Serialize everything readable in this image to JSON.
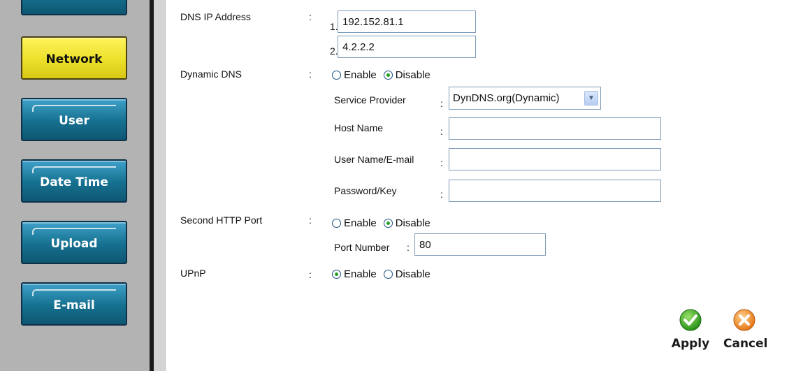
{
  "sidebar": {
    "items": [
      {
        "label": "",
        "active": false
      },
      {
        "label": "Network",
        "active": true
      },
      {
        "label": "User",
        "active": false
      },
      {
        "label": "Date Time",
        "active": false
      },
      {
        "label": "Upload",
        "active": false
      },
      {
        "label": "E-mail",
        "active": false
      }
    ]
  },
  "form": {
    "dns_label": "DNS IP Address",
    "dns_1_num": "1.",
    "dns_1": "192.152.81.1",
    "dns_2_num": "2.",
    "dns_2": "4.2.2.2",
    "ddns_label": "Dynamic DNS",
    "ddns_enable": "Enable",
    "ddns_disable": "Disable",
    "ddns_selected": "Disable",
    "service_provider_label": "Service Provider",
    "service_provider_value": "DynDNS.org(Dynamic)",
    "host_name_label": "Host Name",
    "host_name_value": "",
    "user_name_label": "User Name/E-mail",
    "user_name_value": "",
    "password_label": "Password/Key",
    "password_value": "",
    "http2_label": "Second HTTP Port",
    "http2_enable": "Enable",
    "http2_disable": "Disable",
    "http2_selected": "Disable",
    "port_number_label": "Port Number",
    "port_number_value": "80",
    "upnp_label": "UPnP",
    "upnp_enable": "Enable",
    "upnp_disable": "Disable",
    "upnp_selected": "Enable",
    "colon": ":"
  },
  "actions": {
    "apply_label": "Apply",
    "cancel_label": "Cancel"
  },
  "colors": {
    "nav_blue": "#15708f",
    "nav_active_yellow": "#ece02a",
    "apply_green": "#2f9e1f",
    "cancel_orange": "#f08a1c"
  }
}
